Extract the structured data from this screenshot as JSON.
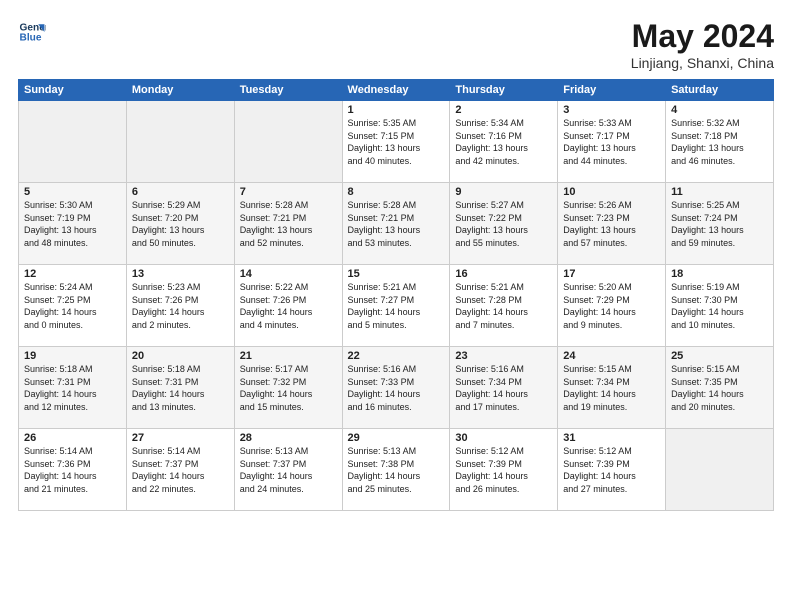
{
  "logo": {
    "line1": "General",
    "line2": "Blue"
  },
  "title": "May 2024",
  "location": "Linjiang, Shanxi, China",
  "days_of_week": [
    "Sunday",
    "Monday",
    "Tuesday",
    "Wednesday",
    "Thursday",
    "Friday",
    "Saturday"
  ],
  "weeks": [
    [
      {
        "day": "",
        "info": ""
      },
      {
        "day": "",
        "info": ""
      },
      {
        "day": "",
        "info": ""
      },
      {
        "day": "1",
        "info": "Sunrise: 5:35 AM\nSunset: 7:15 PM\nDaylight: 13 hours\nand 40 minutes."
      },
      {
        "day": "2",
        "info": "Sunrise: 5:34 AM\nSunset: 7:16 PM\nDaylight: 13 hours\nand 42 minutes."
      },
      {
        "day": "3",
        "info": "Sunrise: 5:33 AM\nSunset: 7:17 PM\nDaylight: 13 hours\nand 44 minutes."
      },
      {
        "day": "4",
        "info": "Sunrise: 5:32 AM\nSunset: 7:18 PM\nDaylight: 13 hours\nand 46 minutes."
      }
    ],
    [
      {
        "day": "5",
        "info": "Sunrise: 5:30 AM\nSunset: 7:19 PM\nDaylight: 13 hours\nand 48 minutes."
      },
      {
        "day": "6",
        "info": "Sunrise: 5:29 AM\nSunset: 7:20 PM\nDaylight: 13 hours\nand 50 minutes."
      },
      {
        "day": "7",
        "info": "Sunrise: 5:28 AM\nSunset: 7:21 PM\nDaylight: 13 hours\nand 52 minutes."
      },
      {
        "day": "8",
        "info": "Sunrise: 5:28 AM\nSunset: 7:21 PM\nDaylight: 13 hours\nand 53 minutes."
      },
      {
        "day": "9",
        "info": "Sunrise: 5:27 AM\nSunset: 7:22 PM\nDaylight: 13 hours\nand 55 minutes."
      },
      {
        "day": "10",
        "info": "Sunrise: 5:26 AM\nSunset: 7:23 PM\nDaylight: 13 hours\nand 57 minutes."
      },
      {
        "day": "11",
        "info": "Sunrise: 5:25 AM\nSunset: 7:24 PM\nDaylight: 13 hours\nand 59 minutes."
      }
    ],
    [
      {
        "day": "12",
        "info": "Sunrise: 5:24 AM\nSunset: 7:25 PM\nDaylight: 14 hours\nand 0 minutes."
      },
      {
        "day": "13",
        "info": "Sunrise: 5:23 AM\nSunset: 7:26 PM\nDaylight: 14 hours\nand 2 minutes."
      },
      {
        "day": "14",
        "info": "Sunrise: 5:22 AM\nSunset: 7:26 PM\nDaylight: 14 hours\nand 4 minutes."
      },
      {
        "day": "15",
        "info": "Sunrise: 5:21 AM\nSunset: 7:27 PM\nDaylight: 14 hours\nand 5 minutes."
      },
      {
        "day": "16",
        "info": "Sunrise: 5:21 AM\nSunset: 7:28 PM\nDaylight: 14 hours\nand 7 minutes."
      },
      {
        "day": "17",
        "info": "Sunrise: 5:20 AM\nSunset: 7:29 PM\nDaylight: 14 hours\nand 9 minutes."
      },
      {
        "day": "18",
        "info": "Sunrise: 5:19 AM\nSunset: 7:30 PM\nDaylight: 14 hours\nand 10 minutes."
      }
    ],
    [
      {
        "day": "19",
        "info": "Sunrise: 5:18 AM\nSunset: 7:31 PM\nDaylight: 14 hours\nand 12 minutes."
      },
      {
        "day": "20",
        "info": "Sunrise: 5:18 AM\nSunset: 7:31 PM\nDaylight: 14 hours\nand 13 minutes."
      },
      {
        "day": "21",
        "info": "Sunrise: 5:17 AM\nSunset: 7:32 PM\nDaylight: 14 hours\nand 15 minutes."
      },
      {
        "day": "22",
        "info": "Sunrise: 5:16 AM\nSunset: 7:33 PM\nDaylight: 14 hours\nand 16 minutes."
      },
      {
        "day": "23",
        "info": "Sunrise: 5:16 AM\nSunset: 7:34 PM\nDaylight: 14 hours\nand 17 minutes."
      },
      {
        "day": "24",
        "info": "Sunrise: 5:15 AM\nSunset: 7:34 PM\nDaylight: 14 hours\nand 19 minutes."
      },
      {
        "day": "25",
        "info": "Sunrise: 5:15 AM\nSunset: 7:35 PM\nDaylight: 14 hours\nand 20 minutes."
      }
    ],
    [
      {
        "day": "26",
        "info": "Sunrise: 5:14 AM\nSunset: 7:36 PM\nDaylight: 14 hours\nand 21 minutes."
      },
      {
        "day": "27",
        "info": "Sunrise: 5:14 AM\nSunset: 7:37 PM\nDaylight: 14 hours\nand 22 minutes."
      },
      {
        "day": "28",
        "info": "Sunrise: 5:13 AM\nSunset: 7:37 PM\nDaylight: 14 hours\nand 24 minutes."
      },
      {
        "day": "29",
        "info": "Sunrise: 5:13 AM\nSunset: 7:38 PM\nDaylight: 14 hours\nand 25 minutes."
      },
      {
        "day": "30",
        "info": "Sunrise: 5:12 AM\nSunset: 7:39 PM\nDaylight: 14 hours\nand 26 minutes."
      },
      {
        "day": "31",
        "info": "Sunrise: 5:12 AM\nSunset: 7:39 PM\nDaylight: 14 hours\nand 27 minutes."
      },
      {
        "day": "",
        "info": ""
      }
    ]
  ]
}
